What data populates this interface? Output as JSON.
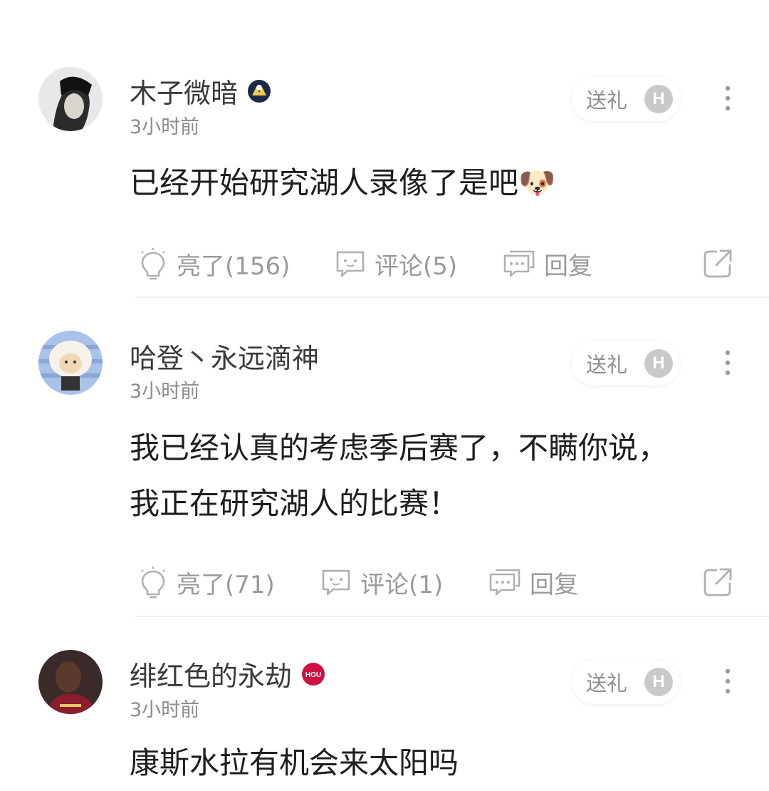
{
  "gift_label": "送礼",
  "coin_letter": "H",
  "comments": [
    {
      "username": "木子微暗",
      "time": "3小时前",
      "text": "已经开始研究湖人录像了是吧🐶",
      "like": "亮了(156)",
      "reply_count": "评论(5)",
      "reply": "回复"
    },
    {
      "username": "哈登丶永远滴神",
      "time": "3小时前",
      "text": "我已经认真的考虑季后赛了，不瞒你说，我正在研究湖人的比赛！",
      "like": "亮了(71)",
      "reply_count": "评论(1)",
      "reply": "回复"
    },
    {
      "username": "绯红色的永劫",
      "time": "3小时前",
      "text": "康斯水拉有机会来太阳吗",
      "badge_text": "HOU"
    }
  ]
}
